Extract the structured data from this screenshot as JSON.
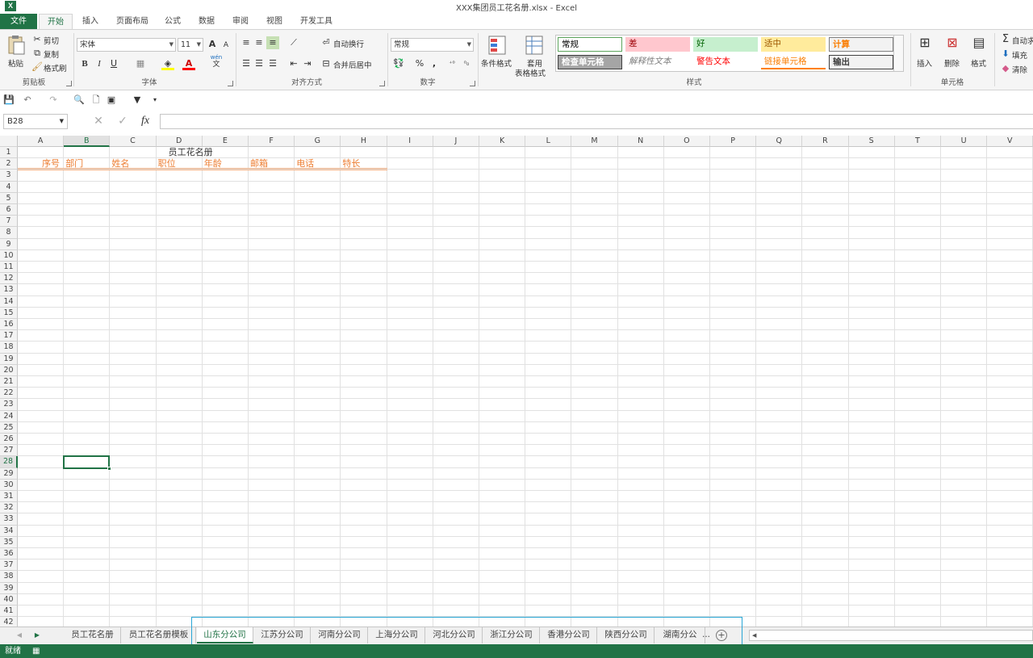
{
  "window": {
    "title": "XXX集团员工花名册.xlsx - Excel",
    "app_icon": "X"
  },
  "ribbon_tabs": [
    "文件",
    "开始",
    "插入",
    "页面布局",
    "公式",
    "数据",
    "审阅",
    "视图",
    "开发工具"
  ],
  "clipboard": {
    "paste": "粘贴",
    "cut": "剪切",
    "copy": "复制",
    "format_painter": "格式刷",
    "label": "剪贴板"
  },
  "font": {
    "name": "宋体",
    "size": "11",
    "label": "字体",
    "bold": "B",
    "italic": "I",
    "underline": "U",
    "grow": "A",
    "shrink": "A",
    "wen": "wén",
    "wen_char": "文"
  },
  "alignment": {
    "wrap": "自动换行",
    "merge": "合并后居中",
    "label": "对齐方式"
  },
  "number": {
    "format": "常规",
    "percent": "%",
    "comma": ",",
    "label": "数字"
  },
  "styles_group": {
    "conditional": "条件格式",
    "table_format_1": "套用",
    "table_format_2": "表格格式",
    "label": "样式",
    "cells": [
      {
        "text": "常规",
        "bg": "#ffffff",
        "color": "#000000",
        "border": "#5ca45c"
      },
      {
        "text": "差",
        "bg": "#ffc7ce",
        "color": "#9c0006",
        "border": ""
      },
      {
        "text": "好",
        "bg": "#c6efce",
        "color": "#006100",
        "border": ""
      },
      {
        "text": "适中",
        "bg": "#ffeb9c",
        "color": "#9c5700",
        "border": ""
      },
      {
        "text": "计算",
        "bg": "#f2f2f2",
        "color": "#fa7d00",
        "border": "#7f7f7f"
      },
      {
        "text": "检查单元格",
        "bg": "#a5a5a5",
        "color": "#ffffff",
        "border": "#3f3f3f"
      },
      {
        "text": "解释性文本",
        "bg": "#ffffff",
        "color": "#7f7f7f",
        "border": ""
      },
      {
        "text": "警告文本",
        "bg": "#ffffff",
        "color": "#ff0000",
        "border": ""
      },
      {
        "text": "链接单元格",
        "bg": "#ffffff",
        "color": "#fa7d00",
        "border": ""
      },
      {
        "text": "输出",
        "bg": "#f2f2f2",
        "color": "#3f3f3f",
        "border": "#3f3f3f"
      }
    ]
  },
  "cells_group": {
    "insert": "插入",
    "delete": "删除",
    "format": "格式",
    "label": "单元格"
  },
  "editing": {
    "autosum": "自动求",
    "fill": "填充",
    "clear": "清除",
    "sigma": "Σ"
  },
  "formula_bar": {
    "name_box": "B28",
    "fx": "fx"
  },
  "columns": [
    "A",
    "B",
    "C",
    "D",
    "E",
    "F",
    "G",
    "H",
    "I",
    "J",
    "K",
    "L",
    "M",
    "N",
    "O",
    "P",
    "Q",
    "R",
    "S",
    "T",
    "U",
    "V"
  ],
  "selected_column": "B",
  "selected_row": 28,
  "sheet": {
    "title_cell": "员工花名册",
    "headers": [
      "序号",
      "部门",
      "姓名",
      "职位",
      "年龄",
      "邮箱",
      "电话",
      "特长"
    ],
    "header_color": "#ed7d31"
  },
  "sheet_tabs": [
    "员工花名册",
    "员工花名册模板",
    "山东分公司",
    "江苏分公司",
    "河南分公司",
    "上海分公司",
    "河北分公司",
    "浙江分公司",
    "香港分公司",
    "陕西分公司",
    "湖南分公"
  ],
  "active_sheet": "山东分公司",
  "more_tabs": "...",
  "status": {
    "ready": "就绪"
  },
  "colors": {
    "accent": "#217346",
    "highlight": "#29a6d6"
  }
}
